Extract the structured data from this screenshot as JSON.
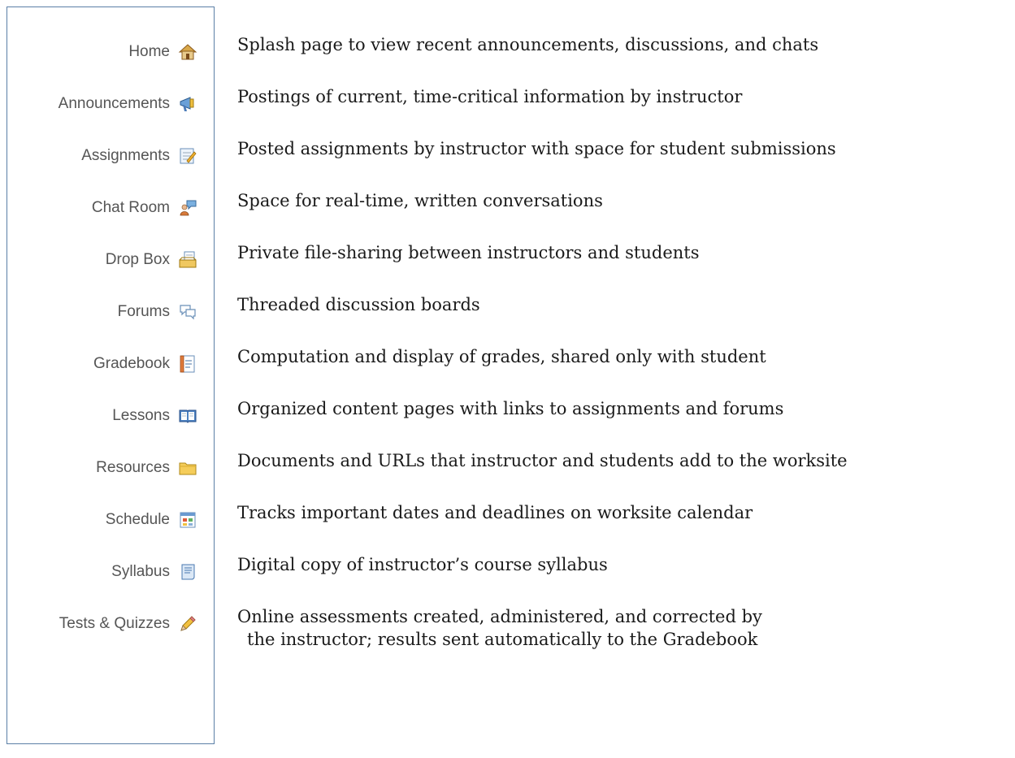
{
  "tools": [
    {
      "label": "Home",
      "icon": "home-icon",
      "description": [
        "Splash page to view recent announcements, discussions, and chats"
      ]
    },
    {
      "label": "Announcements",
      "icon": "announcements-icon",
      "description": [
        "Postings of current, time-critical information by instructor"
      ]
    },
    {
      "label": "Assignments",
      "icon": "assignments-icon",
      "description": [
        "Posted assignments by instructor with space for student submissions"
      ]
    },
    {
      "label": "Chat Room",
      "icon": "chat-room-icon",
      "description": [
        "Space for real-time, written conversations"
      ]
    },
    {
      "label": "Drop Box",
      "icon": "drop-box-icon",
      "description": [
        "Private file-sharing between instructors and students"
      ]
    },
    {
      "label": "Forums",
      "icon": "forums-icon",
      "description": [
        "Threaded discussion boards"
      ]
    },
    {
      "label": "Gradebook",
      "icon": "gradebook-icon",
      "description": [
        "Computation and display of grades, shared only with student"
      ]
    },
    {
      "label": "Lessons",
      "icon": "lessons-icon",
      "description": [
        "Organized content pages with links to assignments and forums"
      ]
    },
    {
      "label": "Resources",
      "icon": "resources-icon",
      "description": [
        "Documents and URLs that instructor and students add to the worksite"
      ]
    },
    {
      "label": "Schedule",
      "icon": "schedule-icon",
      "description": [
        "Tracks important dates and deadlines on worksite calendar"
      ]
    },
    {
      "label": "Syllabus",
      "icon": "syllabus-icon",
      "description": [
        "Digital copy of instructor’s course syllabus"
      ]
    },
    {
      "label": "Tests & Quizzes",
      "icon": "tests-quizzes-icon",
      "description": [
        "Online assessments created, administered, and corrected by",
        "the instructor; results sent automatically to the Gradebook"
      ]
    }
  ],
  "colors": {
    "panel_border": "#5b7fa6",
    "label_text": "#555555",
    "desc_text": "#1a1a1a"
  }
}
